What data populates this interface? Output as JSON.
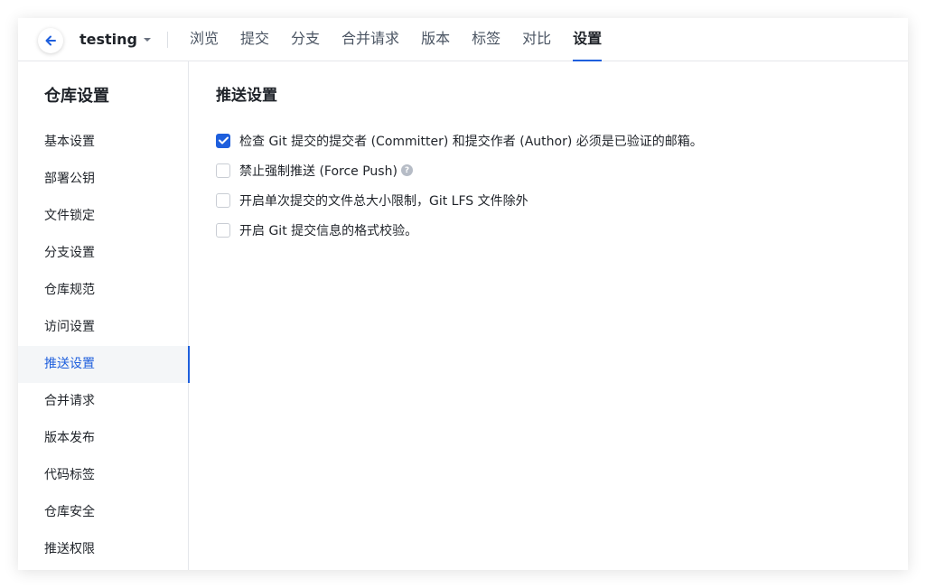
{
  "header": {
    "repo_name": "testing",
    "tabs": [
      {
        "label": "浏览"
      },
      {
        "label": "提交"
      },
      {
        "label": "分支"
      },
      {
        "label": "合并请求"
      },
      {
        "label": "版本"
      },
      {
        "label": "标签"
      },
      {
        "label": "对比"
      },
      {
        "label": "设置"
      }
    ],
    "active_tab": 7
  },
  "sidebar": {
    "title": "仓库设置",
    "items": [
      {
        "label": "基本设置"
      },
      {
        "label": "部署公钥"
      },
      {
        "label": "文件锁定"
      },
      {
        "label": "分支设置"
      },
      {
        "label": "仓库规范"
      },
      {
        "label": "访问设置"
      },
      {
        "label": "推送设置"
      },
      {
        "label": "合并请求"
      },
      {
        "label": "版本发布"
      },
      {
        "label": "代码标签"
      },
      {
        "label": "仓库安全"
      },
      {
        "label": "推送权限"
      }
    ],
    "active_index": 6
  },
  "main": {
    "title": "推送设置",
    "options": [
      {
        "label": "检查 Git 提交的提交者 (Committer) 和提交作者 (Author) 必须是已验证的邮箱。",
        "checked": true,
        "help": false
      },
      {
        "label": "禁止强制推送 (Force Push)",
        "checked": false,
        "help": true
      },
      {
        "label": "开启单次提交的文件总大小限制，Git LFS 文件除外",
        "checked": false,
        "help": false
      },
      {
        "label": "开启 Git 提交信息的格式校验。",
        "checked": false,
        "help": false
      }
    ]
  },
  "colors": {
    "accent": "#1e5fdd",
    "text": "#1f2329",
    "border": "#e5e7eb",
    "active_bg": "#f4f6f8"
  },
  "icons": {
    "back": "arrow-left-icon",
    "caret": "caret-down-icon",
    "check": "check-icon",
    "help": "question-circle-icon"
  }
}
